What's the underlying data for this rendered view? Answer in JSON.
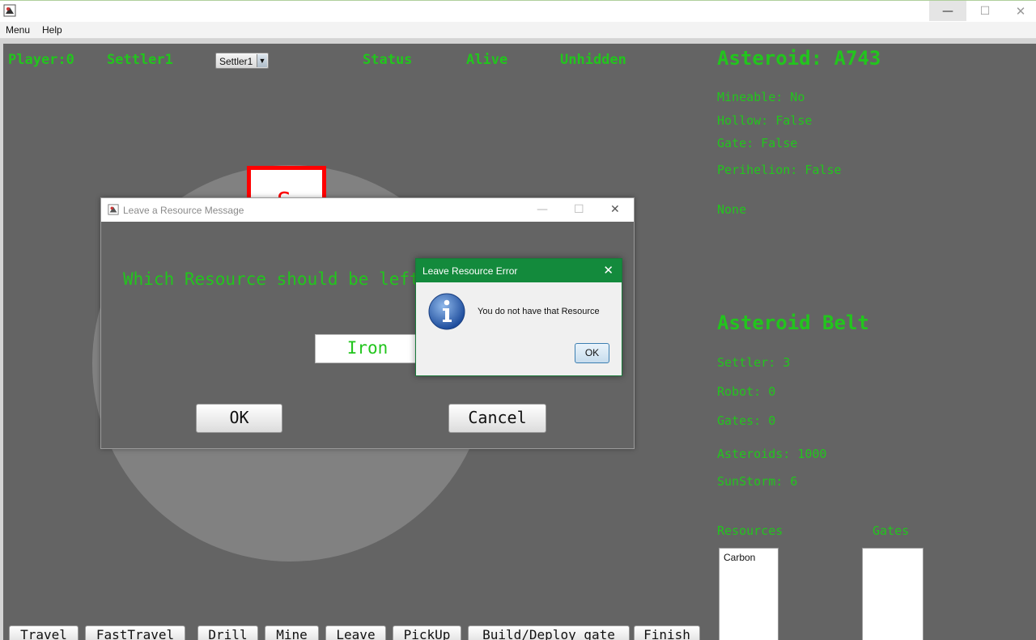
{
  "window": {
    "minimize_glyph": "—",
    "maximize_glyph": "☐",
    "close_glyph": "✕"
  },
  "menu": {
    "items": [
      "Menu",
      "Help"
    ]
  },
  "hud": {
    "player": "Player:0",
    "settler": "Settler1",
    "combo_value": "Settler1",
    "combo_arrow": "▼",
    "status_label": "Status",
    "alive": "Alive",
    "unhidden": "Unhidden"
  },
  "map": {
    "settler_letter": "S"
  },
  "asteroid_panel": {
    "title": "Asteroid: A743",
    "mineable": "Mineable: No",
    "hollow": "Hollow: False",
    "gate": "Gate: False",
    "perihelion": "Perihelion: False",
    "core": "None"
  },
  "belt_panel": {
    "title": "Asteroid Belt",
    "settler": "Settler: 3",
    "robot": "Robot: 0",
    "gates": "Gates: 0",
    "asteroids": "Asteroids: 1000",
    "sunstorm": "SunStorm: 6",
    "resources_label": "Resources",
    "gates_label": "Gates",
    "resources_items": [
      "Carbon"
    ]
  },
  "actions": [
    "Travel",
    "FastTravel",
    "Drill",
    "Mine",
    "Leave",
    "PickUp",
    "Build/Deploy gate",
    "Finish"
  ],
  "leave_dialog": {
    "title": "Leave a Resource Message",
    "question": "Which Resource should be left",
    "field_value": "Iron",
    "ok": "OK",
    "cancel": "Cancel",
    "close_glyph": "✕",
    "min_glyph": "—",
    "max_glyph": "☐"
  },
  "error_dialog": {
    "title": "Leave Resource Error",
    "message": "You do not have that Resource",
    "ok": "OK",
    "close_glyph": "✕"
  },
  "colors": {
    "accent_green": "#22c51d",
    "panel_gray": "#646464",
    "error_title": "#138a3c",
    "settler_red": "#ff0000"
  }
}
